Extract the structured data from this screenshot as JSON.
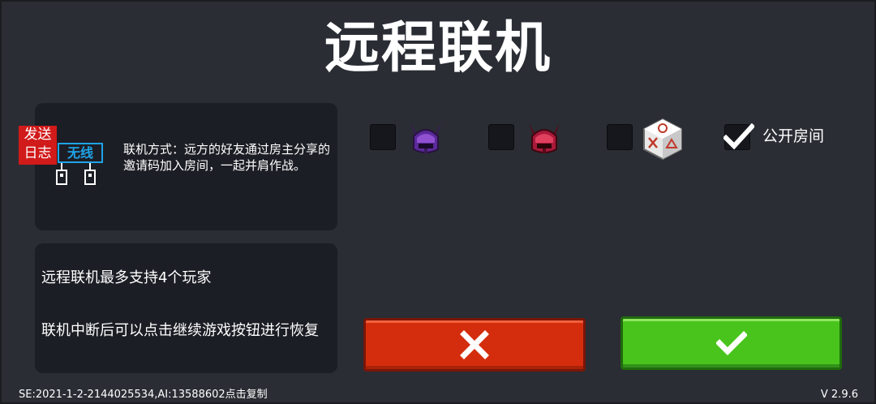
{
  "header": {
    "title": "远程联机"
  },
  "mode_panel": {
    "send_log_line1": "发送",
    "send_log_line2": "日志",
    "mode_icon_label": "无线",
    "description": "联机方式：远方的好友通过房主分享的邀请码加入房间，一起并肩作战。"
  },
  "info_panel": {
    "line1": "远程联机最多支持4个玩家",
    "line2": "联机中断后可以点击继续游戏按钮进行恢复"
  },
  "options": {
    "items": [
      {
        "icon": "purple-horned-helmet-icon",
        "checked": false
      },
      {
        "icon": "red-horned-helmet-icon",
        "checked": false
      },
      {
        "icon": "dice-icon",
        "checked": false
      }
    ],
    "public_room": {
      "label": "公开房间",
      "checked": true
    }
  },
  "buttons": {
    "cancel_icon": "close-icon",
    "confirm_icon": "checkmark-icon",
    "cancel_color": "#d42d0e",
    "confirm_color": "#49c41c"
  },
  "footer": {
    "seed_text": "SE:2021-1-2-2144025534,AI:13588602点击复制",
    "version": "V 2.9.6"
  }
}
